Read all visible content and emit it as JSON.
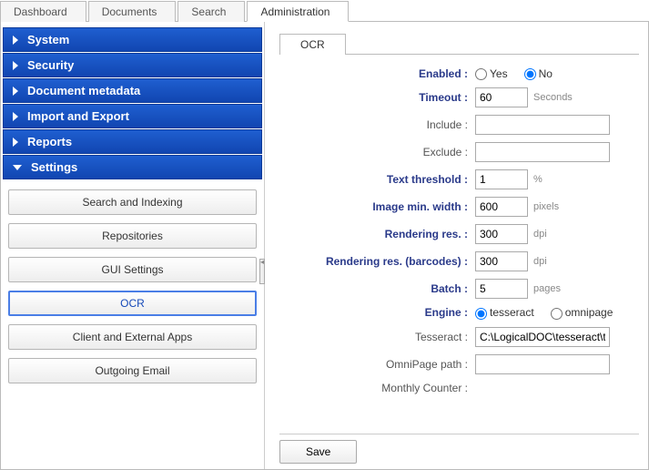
{
  "tabs": {
    "dashboard": "Dashboard",
    "documents": "Documents",
    "search": "Search",
    "administration": "Administration"
  },
  "sidebar": {
    "system": "System",
    "security": "Security",
    "doc_meta": "Document metadata",
    "import_export": "Import and Export",
    "reports": "Reports",
    "settings": "Settings",
    "items": {
      "search_indexing": "Search and Indexing",
      "repositories": "Repositories",
      "gui_settings": "GUI Settings",
      "ocr": "OCR",
      "client_external": "Client and External Apps",
      "outgoing_email": "Outgoing Email"
    }
  },
  "main": {
    "tab_label": "OCR",
    "labels": {
      "enabled": "Enabled :",
      "timeout": "Timeout :",
      "include": "Include :",
      "exclude": "Exclude :",
      "text_threshold": "Text threshold :",
      "image_min_width": "Image min. width :",
      "rendering_res": "Rendering res. :",
      "rendering_res_barcodes": "Rendering res. (barcodes) :",
      "batch": "Batch :",
      "engine": "Engine :",
      "tesseract": "Tesseract :",
      "omnipage_path": "OmniPage path :",
      "monthly_counter": "Monthly Counter :"
    },
    "options": {
      "yes": "Yes",
      "no": "No",
      "tesseract": "tesseract",
      "omnipage": "omnipage"
    },
    "values": {
      "enabled": "No",
      "timeout": "60",
      "include": "",
      "exclude": "",
      "text_threshold": "1",
      "image_min_width": "600",
      "rendering_res": "300",
      "rendering_res_barcodes": "300",
      "batch": "5",
      "engine": "tesseract",
      "tesseract": "C:\\LogicalDOC\\tesseract\\t",
      "omnipage_path": "",
      "monthly_counter": ""
    },
    "units": {
      "seconds": "Seconds",
      "percent": "%",
      "pixels": "pixels",
      "dpi": "dpi",
      "pages": "pages"
    },
    "save": "Save"
  }
}
